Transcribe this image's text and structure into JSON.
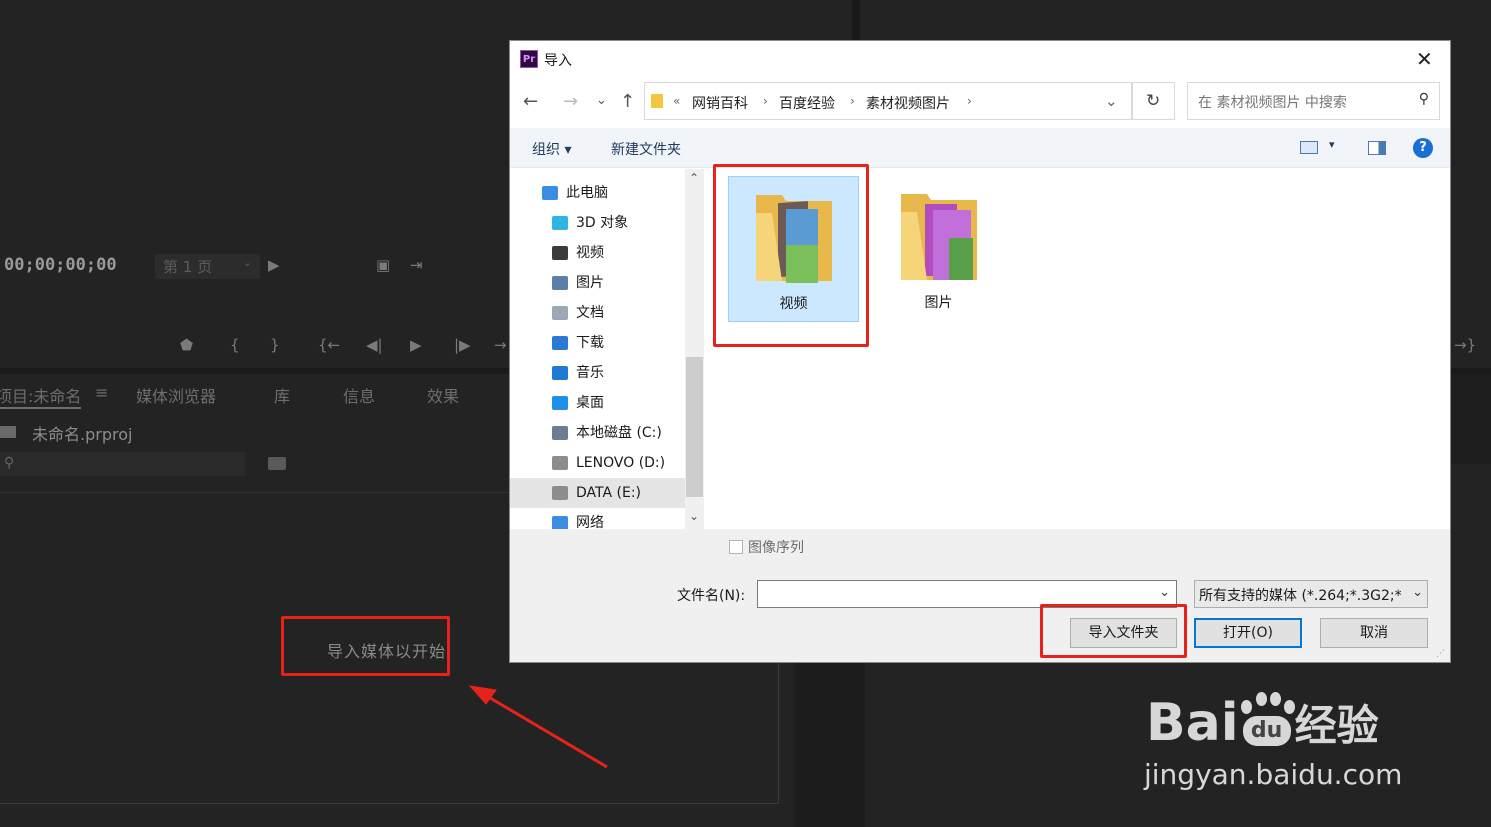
{
  "premiere": {
    "timecode": "00;00;00;00",
    "page_select": "第 1 页",
    "tabs": [
      "项目:未命名",
      "媒体浏览器",
      "库",
      "信息",
      "效果"
    ],
    "project_file": "未命名.prproj",
    "import_hint": "导入媒体以开始"
  },
  "dialog": {
    "title": "导入",
    "app_icon_text": "Pr",
    "breadcrumb": [
      "网销百科",
      "百度经验",
      "素材视频图片"
    ],
    "search_placeholder": "在 素材视频图片 中搜索",
    "organize_label": "组织 ▾",
    "new_folder_label": "新建文件夹",
    "nav_tree": [
      {
        "label": "此电脑",
        "icon": "computer-icon",
        "color": "#3a8de0"
      },
      {
        "label": "3D 对象",
        "icon": "3d-objects-icon",
        "color": "#2fb5e0"
      },
      {
        "label": "视频",
        "icon": "video-icon",
        "color": "#3b3b3b"
      },
      {
        "label": "图片",
        "icon": "pictures-icon",
        "color": "#5a7fa8"
      },
      {
        "label": "文档",
        "icon": "documents-icon",
        "color": "#9aa7b4"
      },
      {
        "label": "下载",
        "icon": "download-icon",
        "color": "#2a7ad4"
      },
      {
        "label": "音乐",
        "icon": "music-icon",
        "color": "#1f78d1"
      },
      {
        "label": "桌面",
        "icon": "desktop-icon",
        "color": "#1e90e8"
      },
      {
        "label": "本地磁盘 (C:)",
        "icon": "drive-c-icon",
        "color": "#6a7d91"
      },
      {
        "label": "LENOVO (D:)",
        "icon": "drive-icon",
        "color": "#8c8c8c"
      },
      {
        "label": "DATA (E:)",
        "icon": "drive-icon",
        "color": "#8c8c8c"
      },
      {
        "label": "网络",
        "icon": "network-icon",
        "color": "#3a8de0"
      }
    ],
    "folders": [
      {
        "name": "视频",
        "selected": true
      },
      {
        "name": "图片",
        "selected": false
      }
    ],
    "image_sequence_label": "图像序列",
    "filename_label": "文件名(N):",
    "filename_value": "",
    "filetype_value": "所有支持的媒体 (*.264;*.3G2;*",
    "import_folder_button": "导入文件夹",
    "open_button": "打开(O)",
    "cancel_button": "取消"
  },
  "watermark": {
    "brand": "Bai",
    "brand_du": "du",
    "brand_suffix": "经验",
    "url": "jingyan.baidu.com"
  },
  "colors": {
    "highlight_red": "#e5231b",
    "accent_blue": "#0078d7"
  }
}
